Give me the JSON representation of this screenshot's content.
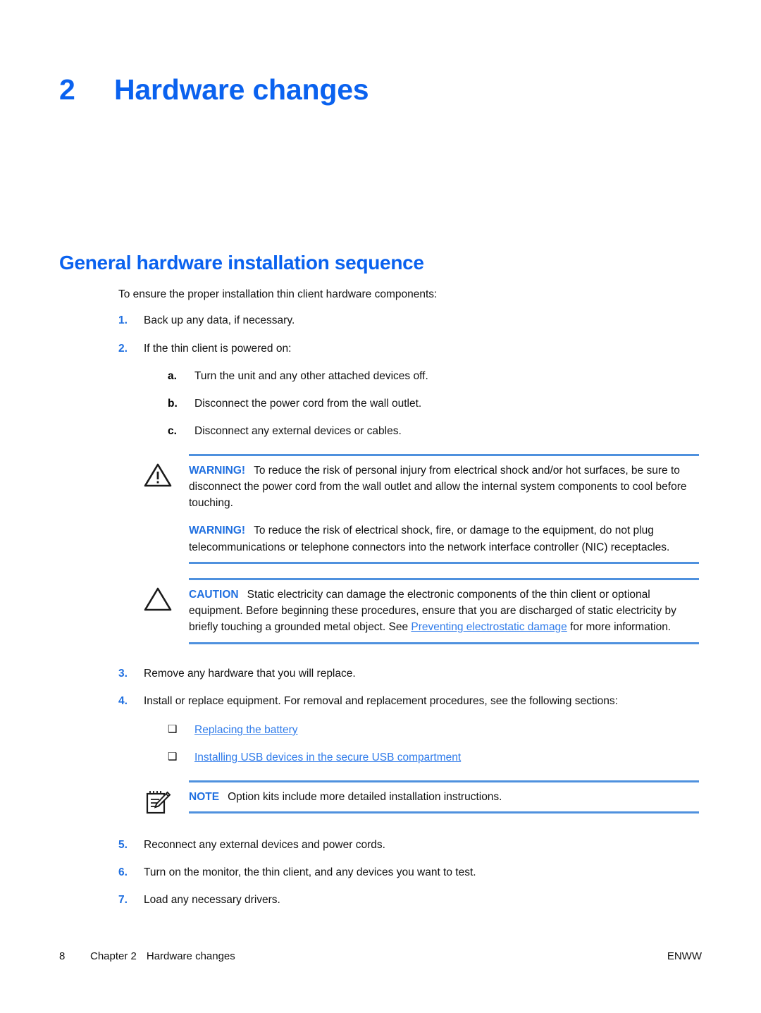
{
  "chapter": {
    "number": "2",
    "title": "Hardware changes"
  },
  "section": {
    "heading": "General hardware installation sequence",
    "intro": "To ensure the proper installation thin client hardware components:"
  },
  "steps": [
    {
      "marker": "1.",
      "text": "Back up any data, if necessary."
    },
    {
      "marker": "2.",
      "text": "If the thin client is powered on:"
    },
    {
      "marker": "3.",
      "text": "Remove any hardware that you will replace."
    },
    {
      "marker": "4.",
      "text": "Install or replace equipment. For removal and replacement procedures, see the following sections:"
    },
    {
      "marker": "5.",
      "text": "Reconnect any external devices and power cords."
    },
    {
      "marker": "6.",
      "text": "Turn on the monitor, the thin client, and any devices you want to test."
    },
    {
      "marker": "7.",
      "text": "Load any necessary drivers."
    }
  ],
  "substeps": [
    {
      "marker": "a.",
      "text": "Turn the unit and any other attached devices off."
    },
    {
      "marker": "b.",
      "text": "Disconnect the power cord from the wall outlet."
    },
    {
      "marker": "c.",
      "text": "Disconnect any external devices or cables."
    }
  ],
  "section_links": [
    {
      "bullet": "❑",
      "text": "Replacing the battery"
    },
    {
      "bullet": "❑",
      "text": "Installing USB devices in the secure USB compartment"
    }
  ],
  "warning_block": {
    "icon": "warning-triangle-icon",
    "paragraphs": [
      {
        "label": "WARNING!",
        "text": "To reduce the risk of personal injury from electrical shock and/or hot surfaces, be sure to disconnect the power cord from the wall outlet and allow the internal system components to cool before touching."
      },
      {
        "label": "WARNING!",
        "text": "To reduce the risk of electrical shock, fire, or damage to the equipment, do not plug telecommunications or telephone connectors into the network interface controller (NIC) receptacles."
      }
    ]
  },
  "caution_block": {
    "icon": "caution-triangle-icon",
    "label": "CAUTION",
    "text_before_link": "Static electricity can damage the electronic components of the thin client or optional equipment. Before beginning these procedures, ensure that you are discharged of static electricity by briefly touching a grounded metal object. See ",
    "link_text": "Preventing electrostatic damage",
    "text_after_link": " for more information."
  },
  "note_block": {
    "icon": "notepad-pencil-icon",
    "label": "NOTE",
    "text": "Option kits include more detailed installation instructions."
  },
  "footer": {
    "page_number": "8",
    "chapter_label": "Chapter 2",
    "chapter_title": "Hardware changes",
    "locale": "ENWW"
  },
  "colors": {
    "heading_blue": "#0a62ef",
    "marker_blue": "#1f6fe0",
    "link_blue": "#2f7bea",
    "rule_blue": "#4f91de"
  }
}
